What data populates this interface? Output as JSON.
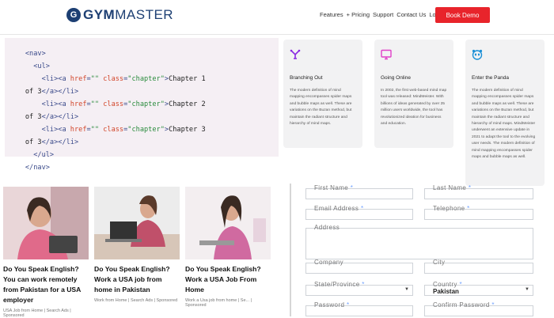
{
  "header": {
    "logo_text_bold": "GYM",
    "logo_text_light": "MASTER",
    "nav": [
      "Features",
      "+ Pricing",
      "Support",
      "Contact Us",
      "Login"
    ],
    "book_demo": "Book Demo"
  },
  "code": {
    "lines": [
      {
        "indent": "     ",
        "parts": [
          [
            "tag",
            "<nav>"
          ]
        ]
      },
      {
        "indent": "       ",
        "parts": [
          [
            "tag",
            "<ul>"
          ]
        ]
      },
      {
        "indent": "         ",
        "parts": [
          [
            "tag",
            "<li><a "
          ],
          [
            "attr",
            "href"
          ],
          [
            "tag",
            "="
          ],
          [
            "str",
            "\"\""
          ],
          [
            "tag",
            " "
          ],
          [
            "attr",
            "class"
          ],
          [
            "tag",
            "="
          ],
          [
            "str",
            "\"chapter\""
          ],
          [
            "tag",
            ">"
          ],
          [
            "txt",
            "Chapter 1"
          ]
        ]
      },
      {
        "indent": "     ",
        "parts": [
          [
            "txt",
            "of 3"
          ],
          [
            "tag",
            "</a></li>"
          ]
        ]
      },
      {
        "indent": "         ",
        "parts": [
          [
            "tag",
            "<li><a "
          ],
          [
            "attr",
            "href"
          ],
          [
            "tag",
            "="
          ],
          [
            "str",
            "\"\""
          ],
          [
            "tag",
            " "
          ],
          [
            "attr",
            "class"
          ],
          [
            "tag",
            "="
          ],
          [
            "str",
            "\"chapter\""
          ],
          [
            "tag",
            ">"
          ],
          [
            "txt",
            "Chapter 2"
          ]
        ]
      },
      {
        "indent": "     ",
        "parts": [
          [
            "txt",
            "of 3"
          ],
          [
            "tag",
            "</a></li>"
          ]
        ]
      },
      {
        "indent": "         ",
        "parts": [
          [
            "tag",
            "<li><a "
          ],
          [
            "attr",
            "href"
          ],
          [
            "tag",
            "="
          ],
          [
            "str",
            "\"\""
          ],
          [
            "tag",
            " "
          ],
          [
            "attr",
            "class"
          ],
          [
            "tag",
            "="
          ],
          [
            "str",
            "\"chapter\""
          ],
          [
            "tag",
            ">"
          ],
          [
            "txt",
            "Chapter 3"
          ]
        ]
      },
      {
        "indent": "     ",
        "parts": [
          [
            "txt",
            "of 3"
          ],
          [
            "tag",
            "</a></li>"
          ]
        ]
      },
      {
        "indent": "       ",
        "parts": [
          [
            "tag",
            "</ul>"
          ]
        ]
      },
      {
        "indent": "     ",
        "parts": [
          [
            "tag",
            "</nav>"
          ]
        ]
      }
    ]
  },
  "cards": [
    {
      "icon": "branch-icon",
      "title": "Branching Out",
      "body": "The modern definition of mind mapping encompasses spider maps and bubble maps as well. These are variations on the Buzan method, but maintain the radiant structure and hierarchy of mind maps."
    },
    {
      "icon": "monitor-icon",
      "title": "Going Online",
      "body": "In 2002, the first web-based mind map tool was released: MindMeister. With billions of ideas generated by over 25 million users worldwide, the tool has revolutionized ideation for business and education."
    },
    {
      "icon": "panda-icon",
      "title": "Enter the Panda",
      "body": "The modern definition of mind mapping encompasses spider maps and bubble maps as well. These are variations on the Buzan method, but maintain the radiant structure and hierarchy of mind maps. MindMeister underwent an extensive update in 2021 to adapt the tool to the evolving user needs. The modern definition of mind mapping encompasses spider maps and bubble maps as well."
    }
  ],
  "ads": [
    {
      "headline": "Do You Speak English? You can work remotely from Pakistan for a USA employer",
      "source": "USA Job from Home | Search Ads | Sponsored"
    },
    {
      "headline": "Do You Speak English? Work a USA job from home in Pakistan",
      "source": "Work from Home | Search Ads | Sponsored"
    },
    {
      "headline": "Do You Speak English? Work a USA Job From Home",
      "source": "Work a Usa job from home | Se... | Sponsored"
    }
  ],
  "form": {
    "first_name": "First Name",
    "last_name": "Last Name",
    "email": "Email Address",
    "telephone": "Telephone",
    "address": "Address",
    "company": "Company",
    "city": "City",
    "state": "State/Province",
    "country_label": "Country",
    "country_value": "Pakistan",
    "password": "Password",
    "confirm_password": "Confirm Password"
  },
  "colors": {
    "brand": "#1d3f73",
    "cta": "#e8242b",
    "branch_icon": "#8a2be2",
    "monitor_icon": "#e040c8",
    "panda_icon": "#1a8fd6"
  }
}
